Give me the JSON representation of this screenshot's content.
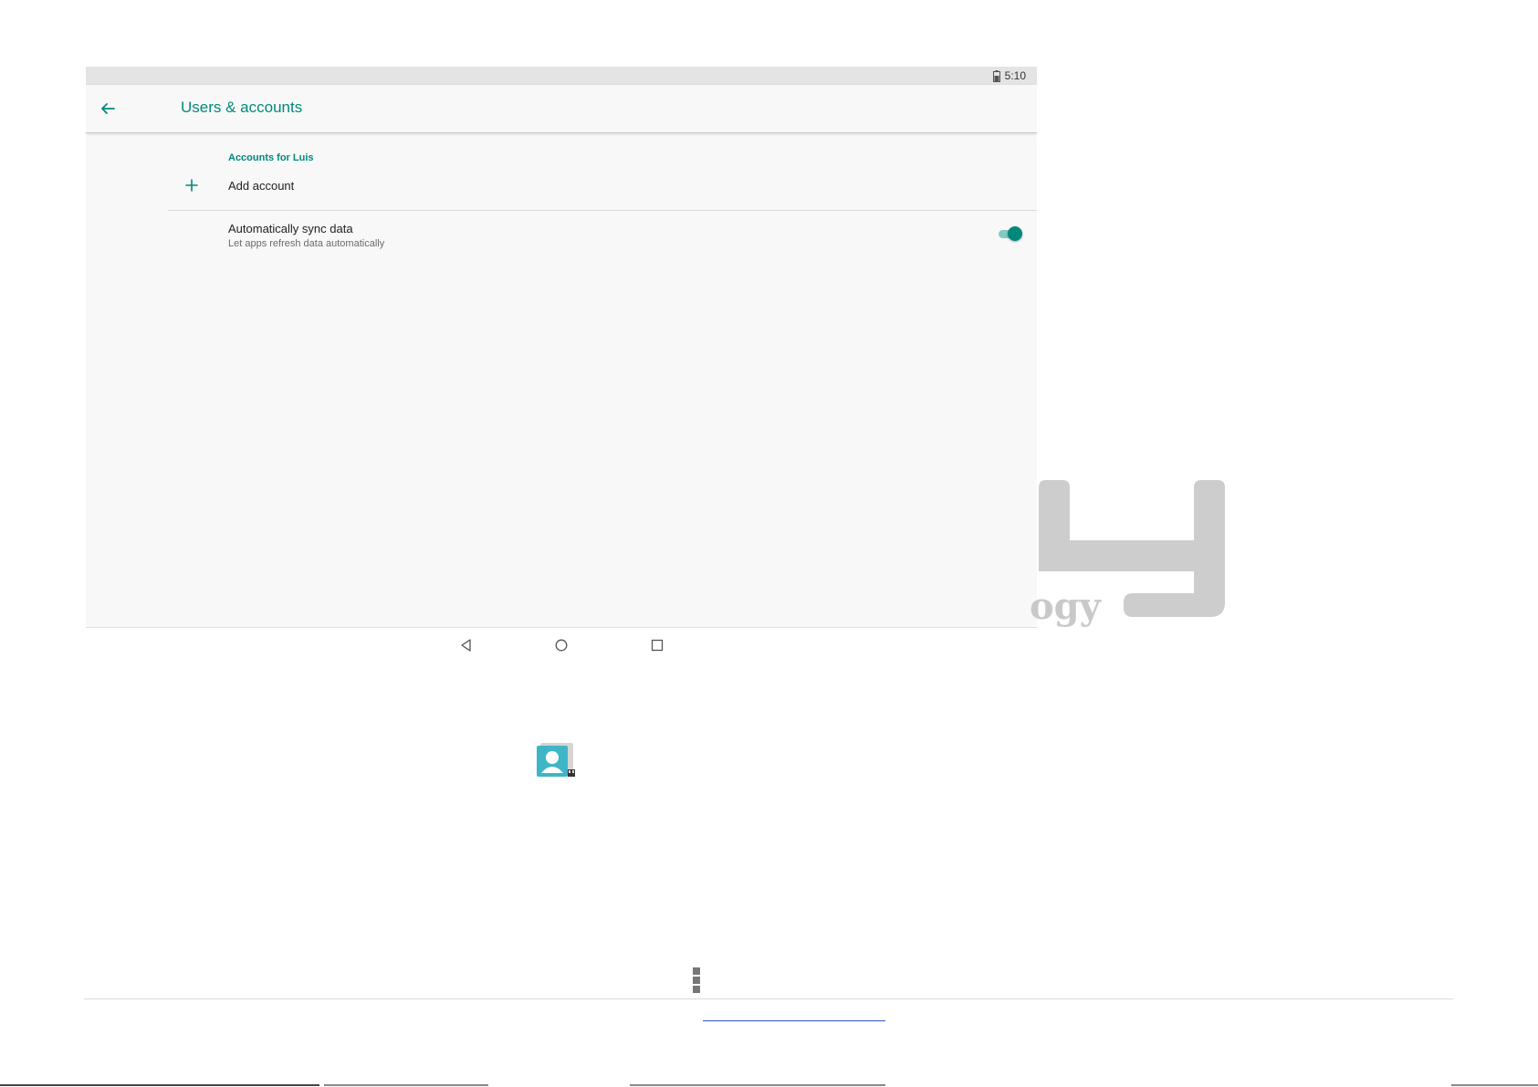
{
  "status_bar": {
    "time": "5:10",
    "battery_icon": "battery-icon"
  },
  "app_bar": {
    "back_icon": "arrow-back-icon",
    "title": "Users & accounts"
  },
  "accounts": {
    "section_header": "Accounts for Luis",
    "add_account_label": "Add account",
    "add_icon": "plus-icon"
  },
  "sync": {
    "title": "Automatically sync data",
    "subtitle": "Let apps refresh data automatically",
    "enabled": true
  },
  "nav_bar": {
    "icons": [
      "back-triangle-icon",
      "home-circle-icon",
      "recents-square-icon"
    ]
  },
  "watermark": {
    "text": "ogy"
  },
  "page": {
    "contacts_icon": "contacts-app-icon",
    "menu_icon": "kebab-menu-icon"
  },
  "colors": {
    "accent": "#00897b",
    "accent_light": "#80cbc4",
    "screen_bg": "#f8f8f8",
    "status_bar_bg": "#e4e4e4",
    "watermark": "#c9c9c9",
    "link": "#2b57c9"
  }
}
